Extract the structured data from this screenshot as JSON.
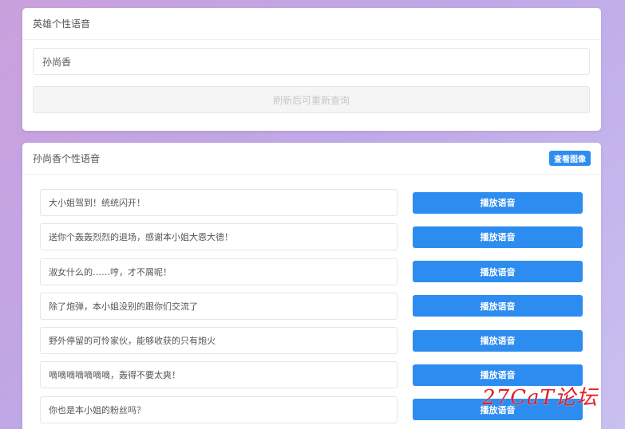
{
  "search_card": {
    "title": "英雄个性语音",
    "input_value": "孙尚香",
    "refresh_label": "刷新后可重新查询"
  },
  "voice_card": {
    "title": "孙尚香个性语音",
    "view_image_label": "查看图像",
    "play_label": "播放语音",
    "voices": [
      {
        "text": "大小姐驾到！统统闪开！"
      },
      {
        "text": "送你个轰轰烈烈的退场，感谢本小姐大恩大德！"
      },
      {
        "text": "淑女什么的……哼，才不屑呢！"
      },
      {
        "text": "除了炮弹，本小姐没别的跟你们交流了"
      },
      {
        "text": "野外停留的可怜家伙，能够收获的只有炮火"
      },
      {
        "text": "嘀嘀嘀嘀嘀嘀嘀，轰得不要太爽！"
      },
      {
        "text": "你也是本小姐的粉丝吗？"
      }
    ]
  },
  "watermark": "27CaT论坛",
  "colors": {
    "primary": "#2d8cf0",
    "watermark": "#e0202a"
  }
}
